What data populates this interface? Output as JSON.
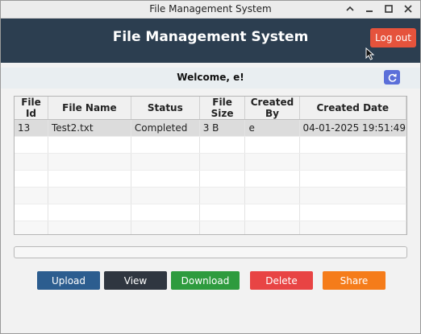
{
  "window": {
    "title": "File Management System"
  },
  "header": {
    "title": "File Management System",
    "logout_label": "Log out"
  },
  "welcome": {
    "text": "Welcome, e!"
  },
  "table": {
    "columns": [
      "File Id",
      "File Name",
      "Status",
      "File Size",
      "Created By",
      "Created Date"
    ],
    "rows": [
      [
        "13",
        "Test2.txt",
        "Completed",
        "3 B",
        "e",
        "04-01-2025 19:51:49"
      ]
    ]
  },
  "buttons": {
    "upload": "Upload",
    "view": "View",
    "download": "Download",
    "delete": "Delete",
    "share": "Share"
  },
  "colors": {
    "header_bg": "#2c3e50",
    "logout": "#e5533c",
    "upload": "#2c5d8f",
    "view": "#2f3640",
    "download": "#2e9b3e",
    "delete": "#e84444",
    "share": "#f57c1a",
    "refresh": "#5b6fd9"
  }
}
